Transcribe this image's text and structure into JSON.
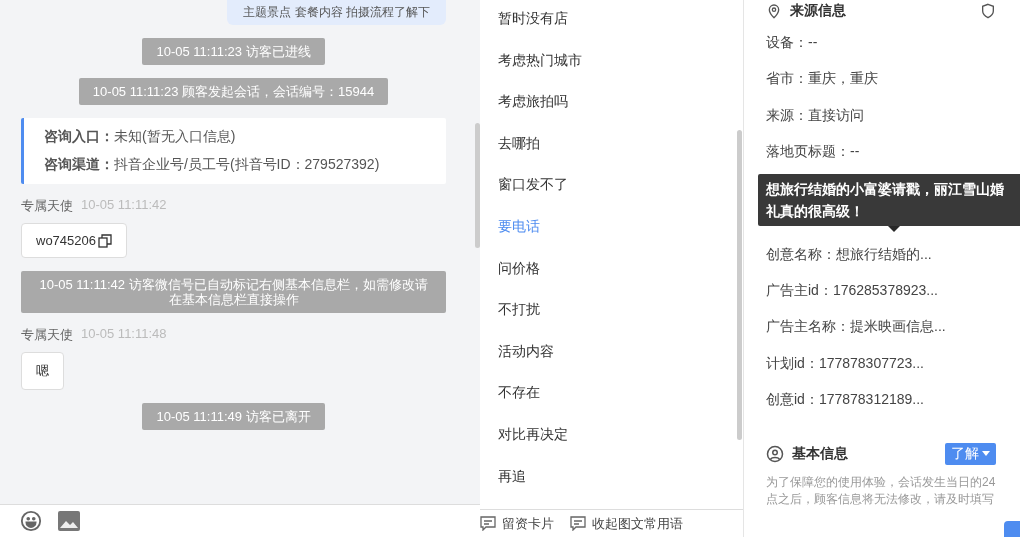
{
  "chat": {
    "messages": [
      {
        "kind": "bubble_out",
        "text": "主题景点 套餐内容 拍摄流程了解下"
      },
      {
        "kind": "system",
        "text": "10-05 11:11:23 访客已进线"
      },
      {
        "kind": "system",
        "text": "10-05 11:11:23 顾客发起会话，会话编号：15944"
      },
      {
        "kind": "info_card",
        "rows": [
          {
            "label": "咨询入口：",
            "value": "未知(暂无入口信息)"
          },
          {
            "label": "咨询渠道：",
            "value": "抖音企业号/员工号(抖音号ID：279527392)"
          }
        ]
      },
      {
        "kind": "message",
        "sender": "专属天使",
        "time": "10-05 11:11:42",
        "text": "wo745206",
        "copyable": true
      },
      {
        "kind": "system",
        "text": "10-05 11:11:42 访客微信号已自动标记右侧基本信息栏，如需修改请在基本信息栏直接操作"
      },
      {
        "kind": "message",
        "sender": "专属天使",
        "time": "10-05 11:11:48",
        "text": "嗯",
        "copyable": false
      },
      {
        "kind": "system",
        "text": "10-05 11:11:49 访客已离开"
      }
    ]
  },
  "quick_replies": {
    "items": [
      {
        "label": "暂时没有店",
        "selected": false
      },
      {
        "label": "考虑热门城市",
        "selected": false
      },
      {
        "label": "考虑旅拍吗",
        "selected": false
      },
      {
        "label": "去哪拍",
        "selected": false
      },
      {
        "label": "窗口发不了",
        "selected": false
      },
      {
        "label": "要电话",
        "selected": true
      },
      {
        "label": "问价格",
        "selected": false
      },
      {
        "label": "不打扰",
        "selected": false
      },
      {
        "label": "活动内容",
        "selected": false
      },
      {
        "label": "不存在",
        "selected": false
      },
      {
        "label": "对比再决定",
        "selected": false
      },
      {
        "label": "再追",
        "selected": false
      }
    ]
  },
  "bottom_actions": [
    "留资卡片",
    "收起图文常用语"
  ],
  "source_info": {
    "title": "来源信息",
    "rows": [
      {
        "kind": "field",
        "text": "设备：--"
      },
      {
        "kind": "field",
        "text": "省市：重庆，重庆"
      },
      {
        "kind": "field",
        "text": "来源：直接访问"
      },
      {
        "kind": "field",
        "text": "落地页标题：--"
      },
      {
        "kind": "tooltip",
        "text": "想旅行结婚的小富婆请戳，丽江雪山婚礼真的很高级！"
      },
      {
        "kind": "field",
        "text": "创意名称：想旅行结婚的..."
      },
      {
        "kind": "field",
        "text": "广告主id：176285378923..."
      },
      {
        "kind": "field",
        "text": "广告主名称：提米映画信息..."
      },
      {
        "kind": "field",
        "text": "计划id：177878307723..."
      },
      {
        "kind": "field",
        "text": "创意id：177878312189..."
      }
    ]
  },
  "basic_info": {
    "title": "基本信息",
    "button": "了解",
    "notice": "为了保障您的使用体验，会话发生当日的24点之后，顾客信息将无法修改，请及时填写"
  }
}
